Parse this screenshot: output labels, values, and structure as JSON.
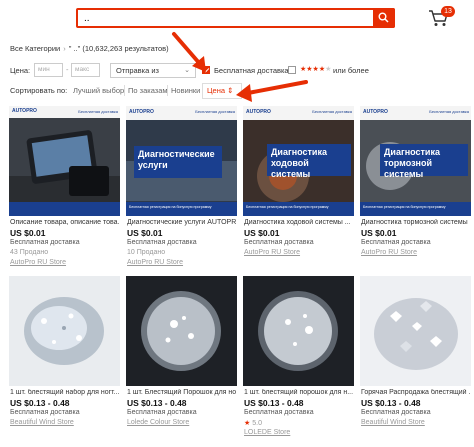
{
  "header": {
    "search_value": "..",
    "cart_count": "13"
  },
  "breadcrumb": {
    "category": "Все Категории",
    "query_text": "\" ..\" (10,632,263 результатов)"
  },
  "filters": {
    "price_label": "Цена:",
    "min_placeholder": "мин",
    "max_placeholder": "макс",
    "ship_from": "Отправка из",
    "free_shipping_label": "Бесплатная доставка",
    "free_shipping_checked": true,
    "rating_stars": "★★★★",
    "rating_star_dim": "★",
    "rating_more": "или более"
  },
  "sort": {
    "label": "Сортировать по:",
    "options": [
      "Лучший выбор",
      "По заказам",
      "Новинки",
      "Цена ⇕"
    ],
    "active_index": 3
  },
  "colors": {
    "accent": "#e62e04",
    "banner_blue": "#1a3f8f"
  },
  "products": [
    {
      "name": "Описание товара, описание това...",
      "price": "US $0.01",
      "shipping": "Бесплатная доставка",
      "sold": "43 Продано",
      "store": "AutoPro RU Store",
      "banner": "",
      "brand": "AUTOPRO",
      "corner": "Бесплатная доставка"
    },
    {
      "name": "Диагностические услуги AUTOPR...",
      "price": "US $0.01",
      "shipping": "Бесплатная доставка",
      "sold": "10 Продано",
      "store": "AutoPro RU Store",
      "banner": "Диагностические услуги",
      "brand": "AUTOPRO",
      "corner": "Бесплатная доставка",
      "footer": "Бесплатная регистрация на бонусную программу"
    },
    {
      "name": "Диагностика ходовой системы ...",
      "price": "US $0.01",
      "shipping": "Бесплатная доставка",
      "sold": "",
      "store": "AutoPro RU Store",
      "banner": "Диагностика ходовой системы",
      "brand": "AUTOPRO",
      "corner": "Бесплатная доставка",
      "footer": "Бесплатная регистрация на бонусную программу"
    },
    {
      "name": "Диагностика тормозной системы ...",
      "price": "US $0.01",
      "shipping": "Бесплатная доставка",
      "sold": "",
      "store": "AutoPro RU Store",
      "banner": "Диагностика тормозной системы",
      "brand": "AUTOPRO",
      "corner": "Бесплатная доставка",
      "footer": "Бесплатная регистрация на бонусную программу"
    },
    {
      "name": "1 шт. блестящий набор для ногт...",
      "price": "US $0.13 - 0.48",
      "shipping": "Бесплатная доставка",
      "sold": "",
      "store": "Beautiful Wind Store"
    },
    {
      "name": "1 шт. Блестящий Порошок для ног...",
      "price": "US $0.13 - 0.48",
      "shipping": "Бесплатная доставка",
      "sold": "",
      "store": "Lolede Colour Store"
    },
    {
      "name": "1 шт. блестящий порошок для н...",
      "price": "US $0.13 - 0.48",
      "shipping": "Бесплатная доставка",
      "rating_star": "★",
      "rating_value": "5.0",
      "store": "LOLEDE Store"
    },
    {
      "name": "Горячая Распродажа блестящий ...",
      "price": "US $0.13 - 0.48",
      "shipping": "Бесплатная доставка",
      "sold": "",
      "store": "Beautiful Wind Store"
    }
  ]
}
